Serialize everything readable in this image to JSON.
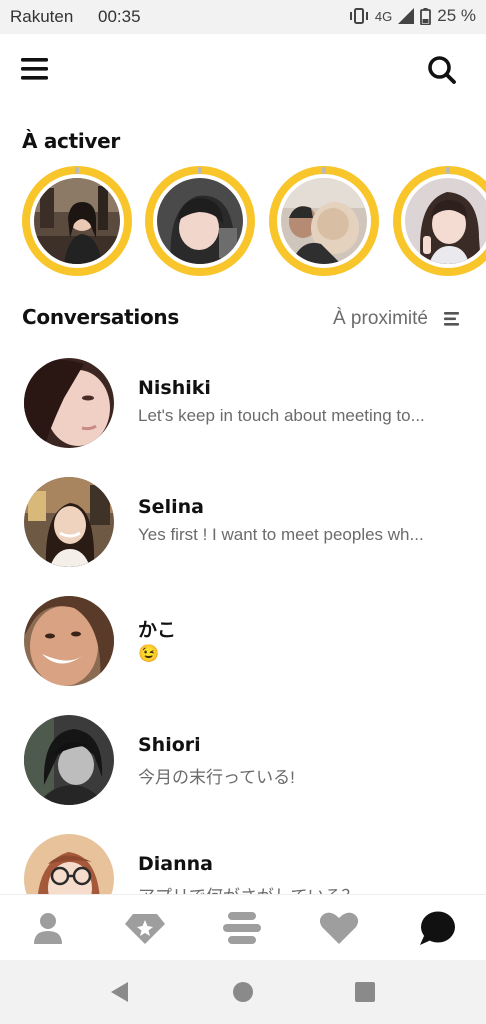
{
  "status_bar": {
    "carrier": "Rakuten",
    "time": "00:35",
    "network": "4G",
    "battery": "25 %"
  },
  "header": {
    "menu_icon": "hamburger-icon",
    "search_icon": "search-icon"
  },
  "activate": {
    "title": "À activer",
    "ring_color": "#f8c52b"
  },
  "conversations": {
    "title": "Conversations",
    "filter_label": "À proximité",
    "items": [
      {
        "name": "Nishiki",
        "message": "Let's keep in touch about meeting to..."
      },
      {
        "name": "Selina",
        "message": "Yes first ! I want to meet peoples wh..."
      },
      {
        "name": "かこ",
        "message": "😉"
      },
      {
        "name": "Shiori",
        "message": "今月の末行っている!"
      },
      {
        "name": "Dianna",
        "message": "アプリで何がさがしている？"
      }
    ]
  },
  "tabs": [
    {
      "icon": "profile-icon",
      "active": false
    },
    {
      "icon": "diamond-icon",
      "active": false
    },
    {
      "icon": "stack-icon",
      "active": false
    },
    {
      "icon": "heart-icon",
      "active": false
    },
    {
      "icon": "chat-bubble-icon",
      "active": true
    }
  ],
  "colors": {
    "accent_yellow": "#f8c52b",
    "tab_inactive": "#9e9e9e",
    "tab_active": "#111111"
  }
}
